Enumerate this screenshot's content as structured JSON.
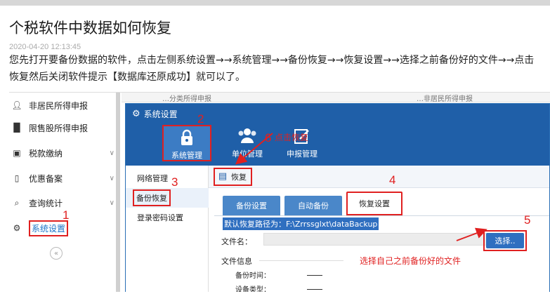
{
  "article": {
    "title": "个税软件中数据如何恢复",
    "date": "2020-04-20 12:13:45",
    "body": "您先打开要备份数据的软件，点击左侧系统设置→→系统管理→→备份恢复→→恢复设置→→选择之前备份好的文件→→点击恢复然后关闭软件提示【数据库还原成功】就可以了。"
  },
  "sidebar": {
    "items": [
      {
        "label": "非居民所得申报",
        "icon": "person-icon"
      },
      {
        "label": "限售股所得申报",
        "icon": "chart-icon"
      },
      {
        "label": "税款缴纳",
        "icon": "tax-icon"
      },
      {
        "label": "优惠备案",
        "icon": "document-icon"
      },
      {
        "label": "查询统计",
        "icon": "search-icon"
      },
      {
        "label": "系统设置",
        "icon": "gear-icon"
      }
    ],
    "collapse": "«"
  },
  "background": {
    "left_text": "…分类所得申报",
    "right_text": "…非居民所得申报"
  },
  "dialog": {
    "title": "系统设置",
    "topnav": [
      {
        "label": "系统管理",
        "icon": "lock-icon"
      },
      {
        "label": "单位管理",
        "icon": "users-icon"
      },
      {
        "label": "申报管理",
        "icon": "edit-icon"
      }
    ],
    "left_menu": [
      "网络管理",
      "备份恢复",
      "登录密码设置"
    ],
    "toolbar": {
      "restore": "恢复"
    },
    "tabs": [
      "备份设置",
      "自动备份",
      "恢复设置"
    ],
    "default_path": "默认恢复路径为：F:\\Zrrssglxt\\dataBackup",
    "file_name_label": "文件名：",
    "select_button": "选择..",
    "file_info_label": "文件信息",
    "file_info_rows": [
      {
        "label": "备份时间：",
        "value": "——"
      },
      {
        "label": "设备类型：",
        "value": "——"
      }
    ]
  },
  "annotations": {
    "n1": "1",
    "n2": "2",
    "n3": "3",
    "n4": "4",
    "n5": "5",
    "n6": "6",
    "click_restore": "点击恢复",
    "choose_file": "选择自己之前备份好的文件"
  },
  "colors": {
    "dialog_header": "#1f5fa8",
    "annotation_red": "#e02020",
    "link_blue": "#1a73c8",
    "tab_blue": "#4a87c9"
  }
}
